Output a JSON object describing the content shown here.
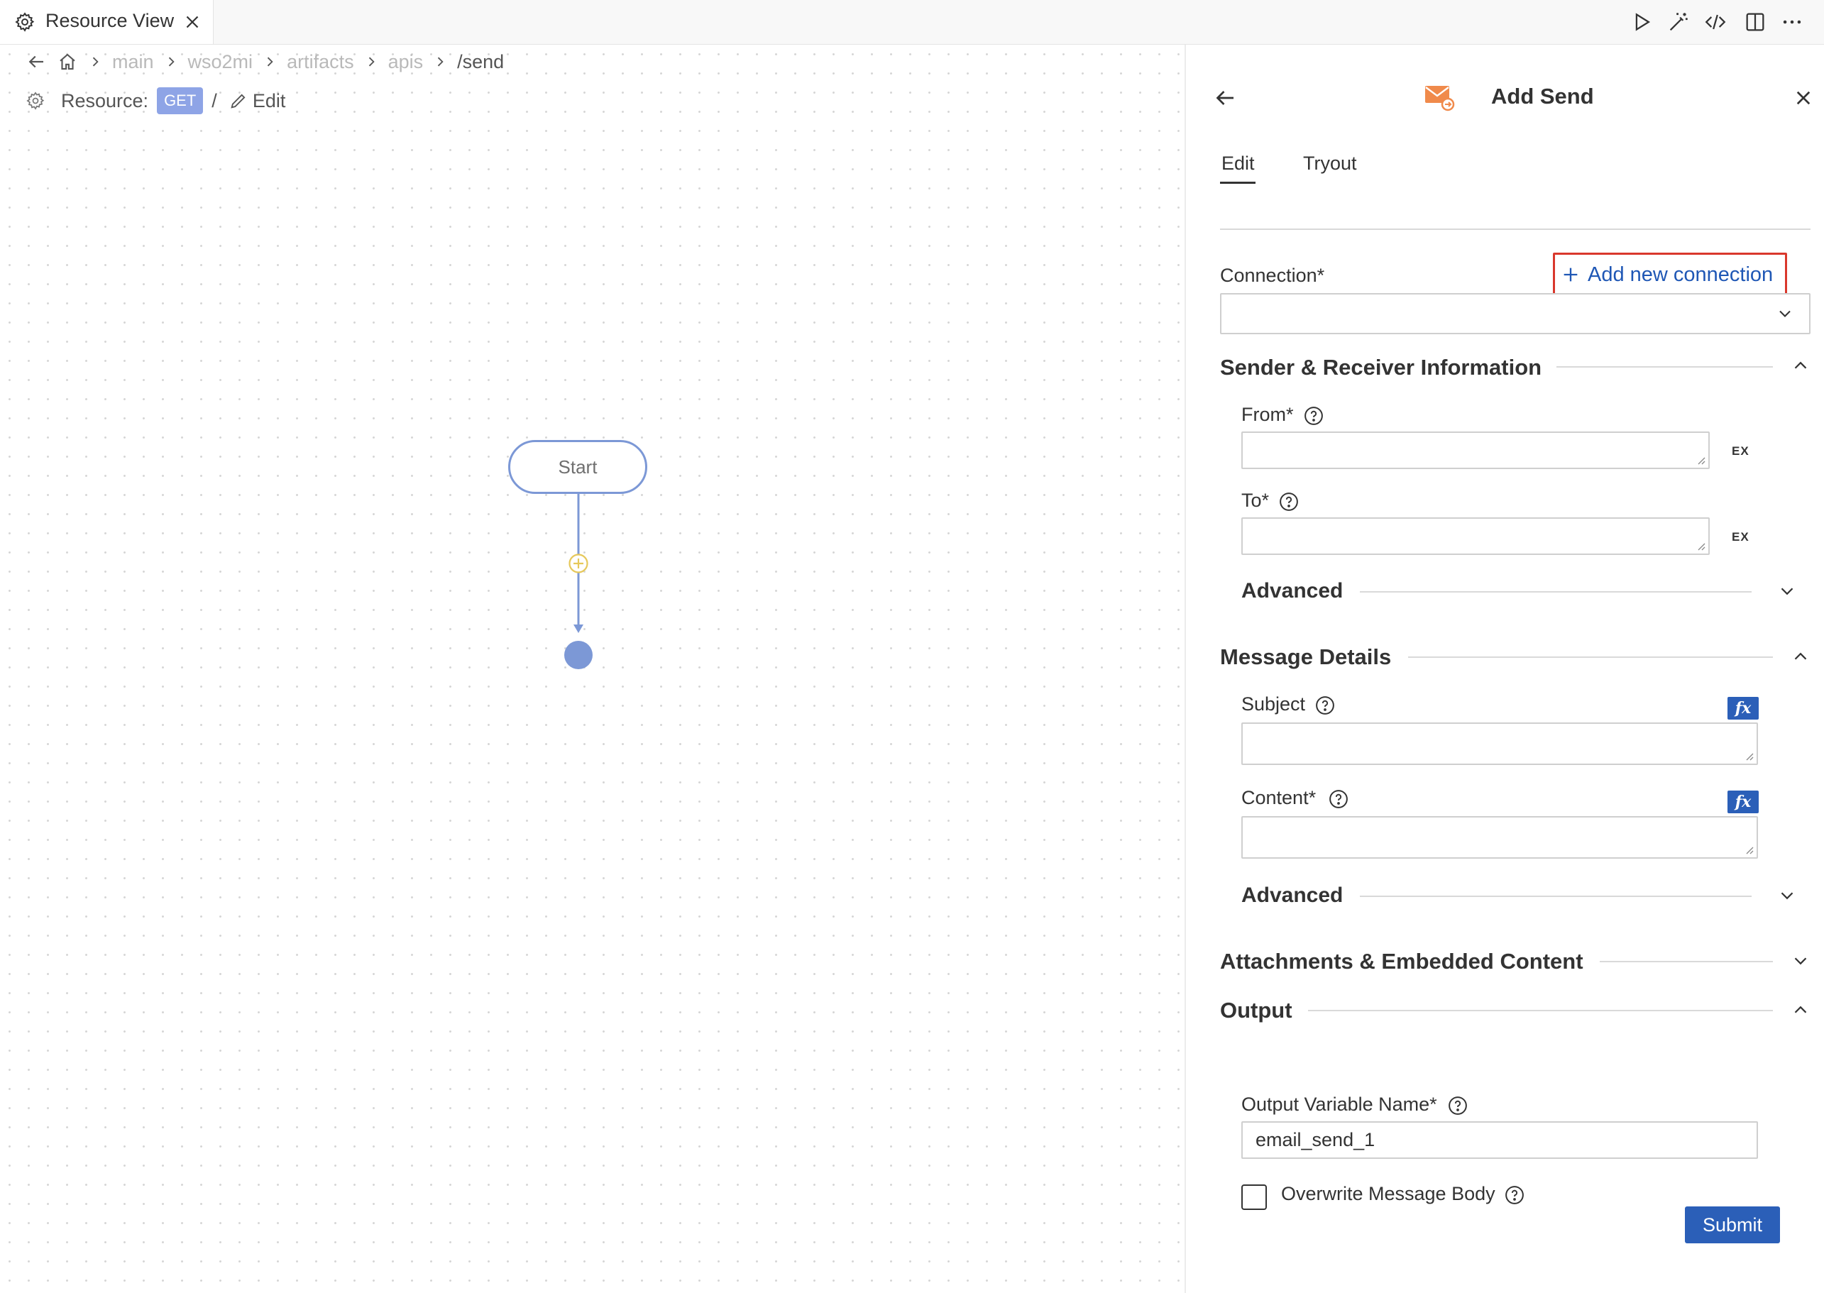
{
  "tab": {
    "title": "Resource View"
  },
  "breadcrumb": {
    "items": [
      "main",
      "wso2mi",
      "artifacts",
      "apis"
    ],
    "current": "/send"
  },
  "resource": {
    "label": "Resource:",
    "method": "GET",
    "separator": "/",
    "edit_label": "Edit"
  },
  "diagram": {
    "start_label": "Start"
  },
  "panel": {
    "title": "Add Send",
    "tabs": [
      {
        "label": "Edit",
        "active": true
      },
      {
        "label": "Tryout",
        "active": false
      }
    ],
    "connection": {
      "label": "Connection*",
      "add_label": "Add new connection",
      "value": ""
    },
    "sender_section": {
      "title": "Sender & Receiver Information",
      "from": {
        "label": "From*",
        "value": "",
        "ex_label": "EX"
      },
      "to": {
        "label": "To*",
        "value": "",
        "ex_label": "EX"
      },
      "advanced_label": "Advanced"
    },
    "message_section": {
      "title": "Message Details",
      "subject": {
        "label": "Subject",
        "value": "",
        "fx_label": "fx"
      },
      "content": {
        "label": "Content*",
        "value": "",
        "fx_label": "fx"
      },
      "advanced_label": "Advanced"
    },
    "attachments_section": {
      "title": "Attachments & Embedded Content"
    },
    "output_section": {
      "title": "Output",
      "variable": {
        "label": "Output Variable Name*",
        "value": "email_send_1"
      },
      "overwrite": {
        "label": "Overwrite Message Body",
        "checked": false
      }
    },
    "submit_label": "Submit"
  },
  "colors": {
    "accent": "#2b5fb8",
    "link": "#1f57b5",
    "highlight_border": "#d9382c",
    "method_badge": "#8ea4e6",
    "node_border": "#7c98d6",
    "plus_node": "#e6c85a"
  }
}
